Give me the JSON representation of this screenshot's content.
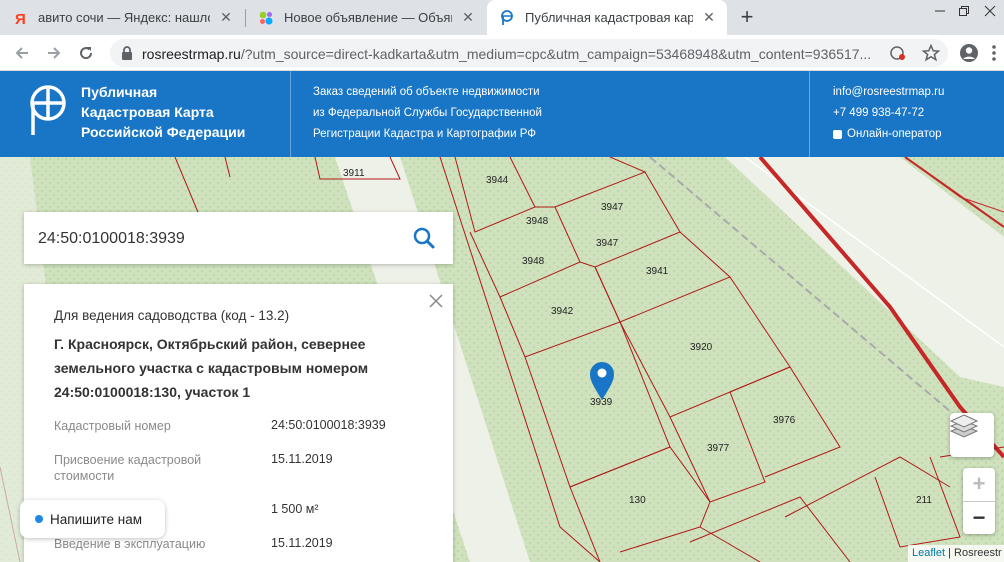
{
  "browser": {
    "tabs": [
      {
        "title": "авито сочи — Яндекс: нашлось",
        "icon": "yandex-icon"
      },
      {
        "title": "Новое объявление — Объявлен",
        "icon": "avito-icon"
      },
      {
        "title": "Публичная кадастровая карта",
        "icon": "cadastral-map-icon",
        "active": true
      }
    ],
    "new_tab": "+",
    "url_domain": "rosreestrmap.ru",
    "url_rest": "/?utm_source=direct-kadkarta&utm_medium=cpc&utm_campaign=53468948&utm_content=936517..."
  },
  "header": {
    "title_lines": [
      "Публичная",
      "Кадастровая Карта",
      "Российской Федерации"
    ],
    "order_lines": [
      "Заказ сведений об объекте недвижимости",
      "из Федеральной Службы Государственной",
      "Регистрации Кадастра и Картографии РФ"
    ],
    "email": "info@rosreestrmap.ru",
    "phone": "+7 499 938-47-72",
    "operator": "Онлайн-оператор",
    "brand_color": "#1976c6"
  },
  "search": {
    "value": "24:50:0100018:3939"
  },
  "info_card": {
    "purpose": "Для ведения садоводства (код - 13.2)",
    "address": "Г. Красноярск, Октябрьский район, севернее земельного участка с кадастровым номером 24:50:0100018:130, участок 1",
    "rows": [
      {
        "label": "Кадастровый номер",
        "value": "24:50:0100018:3939"
      },
      {
        "label": "Присвоение кадастровой стоимости",
        "value": "15.11.2019"
      },
      {
        "label": "Площадь",
        "value": "1 500 м²"
      },
      {
        "label": "Введение в эксплуатацию",
        "value": "15.11.2019"
      }
    ]
  },
  "chat": {
    "label": "Напишите нам"
  },
  "map": {
    "parcel_labels": [
      "3911",
      "3944",
      "3947",
      "3948",
      "3947",
      "3948",
      "3941",
      "3942",
      "3920",
      "3939",
      "3976",
      "3977",
      "130",
      "211"
    ],
    "zoom_in": "+",
    "zoom_out": "−",
    "attribution_link": "Leaflet",
    "attribution_text": "| Rosreestr"
  }
}
